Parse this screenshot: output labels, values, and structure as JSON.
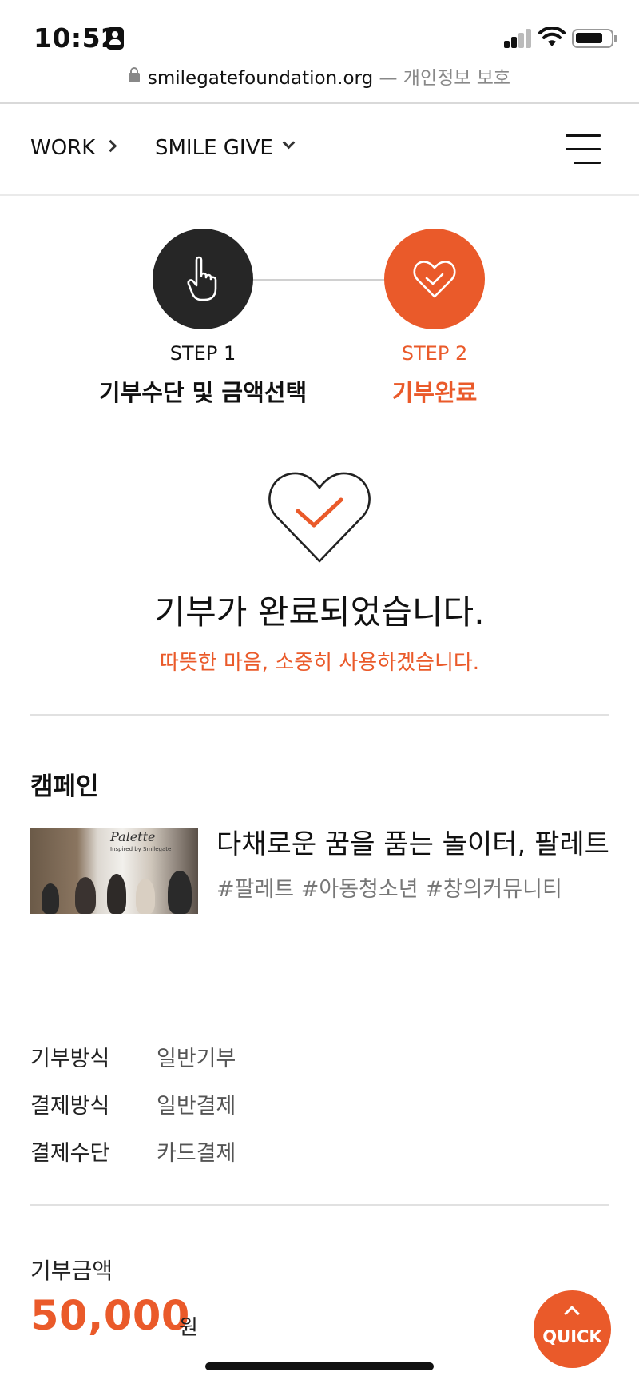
{
  "status_bar": {
    "time": "10:52"
  },
  "browser": {
    "domain": "smilegatefoundation.org",
    "suffix": " — 개인정보 보호"
  },
  "nav": {
    "work": "WORK",
    "smile_give": "SMILE GIVE"
  },
  "steps": [
    {
      "number": "STEP 1",
      "title": "기부수단 및 금액선택",
      "icon": "pointing-hand-icon"
    },
    {
      "number": "STEP 2",
      "title": "기부완료",
      "icon": "heart-check-icon"
    }
  ],
  "completion": {
    "title": "기부가 완료되었습니다.",
    "subtitle": "따뜻한 마음, 소중히 사용하겠습니다."
  },
  "campaign": {
    "section_title": "캠페인",
    "title": "다채로운 꿈을 품는 놀이터, 팔레트",
    "tags": "#팔레트 #아동청소년 #창의커뮤니티",
    "thumbnail_logo": "Palette",
    "thumbnail_sub": "Inspired by Smilegate"
  },
  "details": [
    {
      "label": "기부방식",
      "value": "일반기부"
    },
    {
      "label": "결제방식",
      "value": "일반결제"
    },
    {
      "label": "결제수단",
      "value": "카드결제"
    }
  ],
  "amount": {
    "label": "기부금액",
    "value": "50,000",
    "unit": "원"
  },
  "quick_button": {
    "label": "QUICK"
  },
  "colors": {
    "accent": "#ea5a2a",
    "dark": "#262626",
    "divider": "#e1e1e1"
  }
}
